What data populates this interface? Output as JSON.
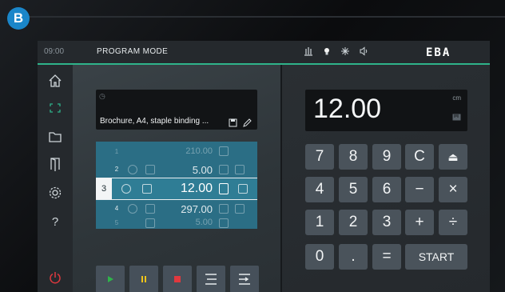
{
  "badge": "B",
  "topbar": {
    "time": "09:00",
    "mode": "PROGRAM MODE",
    "icons": [
      "height-icon",
      "light-bulb-icon",
      "sparkle-icon",
      "sound-icon"
    ],
    "logo": "EBA",
    "accent": "#2fb38a"
  },
  "sidebar": {
    "items": [
      "home-icon",
      "focus-icon",
      "folder-icon",
      "door-icon",
      "settings-icon",
      "help-icon",
      "power-icon"
    ],
    "help_label": "?",
    "power_color": "#e0383e"
  },
  "program": {
    "name": "Brochure, A4, staple binding ..."
  },
  "steps": [
    {
      "num": "1",
      "value": "210.00",
      "state": "dim"
    },
    {
      "num": "2",
      "value": "5.00",
      "state": "mid"
    },
    {
      "num": "3",
      "value": "12.00",
      "state": "active"
    },
    {
      "num": "4",
      "value": "297.00",
      "state": "mid"
    },
    {
      "num": "5",
      "value": "5.00",
      "state": "dim"
    }
  ],
  "controls": [
    "play-icon",
    "pause-icon",
    "stop-icon",
    "align-icon",
    "align-right-icon"
  ],
  "control_colors": {
    "play": "#2fb34a",
    "pause": "#f0c419",
    "stop": "#e0383e"
  },
  "display": {
    "value": "12.00",
    "unit": "cm"
  },
  "keypad": {
    "rows": [
      [
        "7",
        "8",
        "9",
        "C",
        "⏏"
      ],
      [
        "4",
        "5",
        "6",
        "−",
        "×"
      ],
      [
        "1",
        "2",
        "3",
        "+",
        "÷"
      ]
    ],
    "zero": "0",
    "dot": ".",
    "equals": "=",
    "start": "START"
  }
}
